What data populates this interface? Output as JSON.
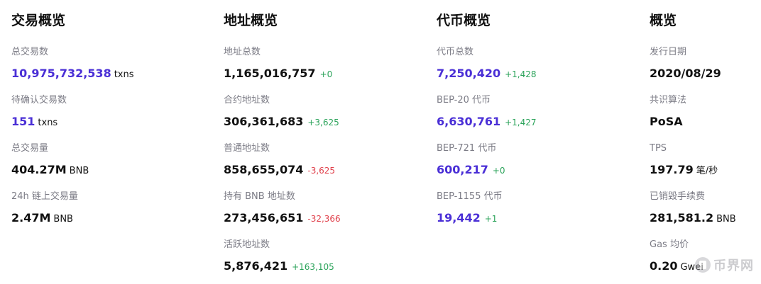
{
  "columns": [
    {
      "title": "交易概览",
      "stats": [
        {
          "label": "总交易数",
          "value": "10,975,732,538",
          "unit": "txns",
          "accent": true
        },
        {
          "label": "待确认交易数",
          "value": "151",
          "unit": "txns",
          "accent": true
        },
        {
          "label": "总交易量",
          "value": "404.27M",
          "unit": "BNB"
        },
        {
          "label": "24h 链上交易量",
          "value": "2.47M",
          "unit": "BNB"
        }
      ]
    },
    {
      "title": "地址概览",
      "stats": [
        {
          "label": "地址总数",
          "value": "1,165,016,757",
          "delta": "+0",
          "trend": "up"
        },
        {
          "label": "合约地址数",
          "value": "306,361,683",
          "delta": "+3,625",
          "trend": "up"
        },
        {
          "label": "普通地址数",
          "value": "858,655,074",
          "delta": "-3,625",
          "trend": "down"
        },
        {
          "label": "持有 BNB 地址数",
          "value": "273,456,651",
          "delta": "-32,366",
          "trend": "down"
        },
        {
          "label": "活跃地址数",
          "value": "5,876,421",
          "delta": "+163,105",
          "trend": "up"
        }
      ]
    },
    {
      "title": "代币概览",
      "stats": [
        {
          "label": "代币总数",
          "value": "7,250,420",
          "delta": "+1,428",
          "trend": "up",
          "accent": true
        },
        {
          "label": "BEP-20 代币",
          "value": "6,630,761",
          "delta": "+1,427",
          "trend": "up",
          "accent": true
        },
        {
          "label": "BEP-721 代币",
          "value": "600,217",
          "delta": "+0",
          "trend": "up",
          "accent": true
        },
        {
          "label": "BEP-1155 代币",
          "value": "19,442",
          "delta": "+1",
          "trend": "up",
          "accent": true
        }
      ]
    },
    {
      "title": "概览",
      "stats": [
        {
          "label": "发行日期",
          "value": "2020/08/29"
        },
        {
          "label": "共识算法",
          "value": "PoSA"
        },
        {
          "label": "TPS",
          "value": "197.79",
          "unit": "笔/秒"
        },
        {
          "label": "已销毁手续费",
          "value": "281,581.2",
          "unit": "BNB"
        },
        {
          "label": "Gas 均价",
          "value": "0.20",
          "unit": "Gwei"
        }
      ]
    }
  ],
  "watermark": {
    "text": "币界网",
    "icon": "coin-logo-icon"
  },
  "colors": {
    "accent": "#4a2fd6",
    "up": "#2ba35a",
    "down": "#e0404b",
    "label": "#7c7c86",
    "text": "#111111"
  }
}
